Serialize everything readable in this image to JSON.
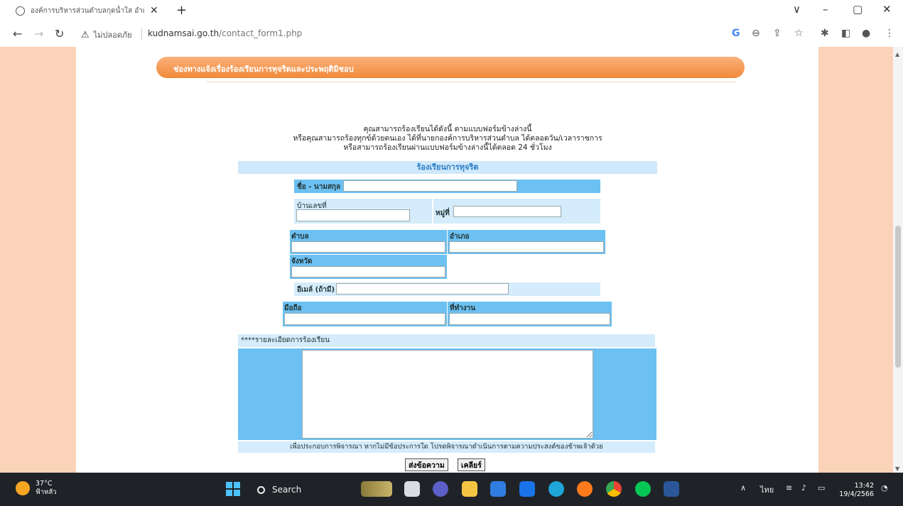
{
  "browser": {
    "tab_title": "องค์การบริหารส่วนตำบลกุดน้ำใส อำเภ",
    "new_tab": "+",
    "window_controls": {
      "minimize": "–",
      "maximize": "▢",
      "close": "✕",
      "dropdown": "∨"
    },
    "security_label": "ไม่ปลอดภัย",
    "url_host": "kudnamsai.go.th",
    "url_path": "/contact_form1.php"
  },
  "page": {
    "banner_title": "ช่องทางแจ้งเรื่องร้องเรียนการทุจริตและประพฤติมิชอบ",
    "intro_lines": [
      "คุณสามารถร้องเรียนได้ดังนี้ ตามแบบฟอร์มข้างล่างนี้",
      "หรือคุณสามารถร้องทุกข์ด้วยตนเอง ได้ที่นายกองค์การบริหารส่วนตำบล ได้ตลอดวัน/เวลาราชการ",
      "หรือสามารถร้องเรียนผ่านแบบฟอร์มข้างล่างนี้ได้ตลอด 24 ชั่วโมง"
    ],
    "form": {
      "section_title": "ร้องเรียนการทุจริต",
      "name_label": "ชื่อ - นามสกุล",
      "house_no_label": "บ้านเลขที่",
      "moo_label": "หมู่ที่",
      "subdistrict_label": "ตำบล",
      "district_label": "อำเภอ",
      "province_label": "จังหวัด",
      "email_label": "อีเมล์ (ถ้ามี)",
      "mobile_label": "มือถือ",
      "work_label": "ที่ทำงาน",
      "detail_label": "****รายละเอียดการร้องเรียน",
      "note": "เพื่อประกอบการพิจารณา หากไม่มีข้อประการใด โปรดพิจารณาดำเนินการตามความประสงค์ของข้าพเจ้าด้วย",
      "submit_label": "ส่งข้อความ",
      "clear_label": "เคลียร์"
    }
  },
  "taskbar": {
    "weather_temp": "37°C",
    "weather_desc": "ฟ้าหลัว",
    "search_label": "Search",
    "lang": "ไทย",
    "time": "13:42",
    "date": "19/4/2566"
  },
  "colors": {
    "side_panel": "#fbd3b8",
    "banner": "#f08a3a",
    "form_blue": "#6cc0f2",
    "form_light": "#d4ecfb",
    "taskbar": "#1f2328"
  }
}
